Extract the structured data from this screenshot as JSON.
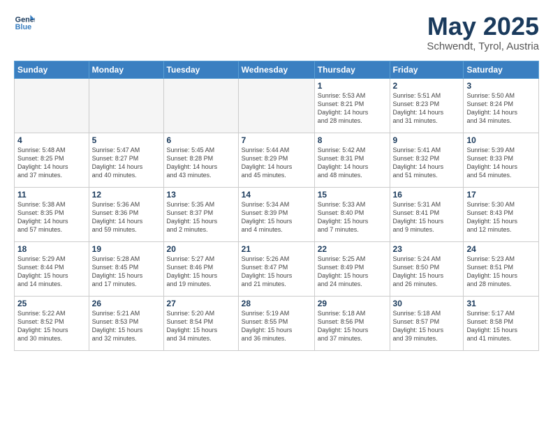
{
  "header": {
    "logo_line1": "General",
    "logo_line2": "Blue",
    "month": "May 2025",
    "location": "Schwendt, Tyrol, Austria"
  },
  "days_of_week": [
    "Sunday",
    "Monday",
    "Tuesday",
    "Wednesday",
    "Thursday",
    "Friday",
    "Saturday"
  ],
  "weeks": [
    [
      {
        "day": "",
        "info": ""
      },
      {
        "day": "",
        "info": ""
      },
      {
        "day": "",
        "info": ""
      },
      {
        "day": "",
        "info": ""
      },
      {
        "day": "1",
        "info": "Sunrise: 5:53 AM\nSunset: 8:21 PM\nDaylight: 14 hours\nand 28 minutes."
      },
      {
        "day": "2",
        "info": "Sunrise: 5:51 AM\nSunset: 8:23 PM\nDaylight: 14 hours\nand 31 minutes."
      },
      {
        "day": "3",
        "info": "Sunrise: 5:50 AM\nSunset: 8:24 PM\nDaylight: 14 hours\nand 34 minutes."
      }
    ],
    [
      {
        "day": "4",
        "info": "Sunrise: 5:48 AM\nSunset: 8:25 PM\nDaylight: 14 hours\nand 37 minutes."
      },
      {
        "day": "5",
        "info": "Sunrise: 5:47 AM\nSunset: 8:27 PM\nDaylight: 14 hours\nand 40 minutes."
      },
      {
        "day": "6",
        "info": "Sunrise: 5:45 AM\nSunset: 8:28 PM\nDaylight: 14 hours\nand 43 minutes."
      },
      {
        "day": "7",
        "info": "Sunrise: 5:44 AM\nSunset: 8:29 PM\nDaylight: 14 hours\nand 45 minutes."
      },
      {
        "day": "8",
        "info": "Sunrise: 5:42 AM\nSunset: 8:31 PM\nDaylight: 14 hours\nand 48 minutes."
      },
      {
        "day": "9",
        "info": "Sunrise: 5:41 AM\nSunset: 8:32 PM\nDaylight: 14 hours\nand 51 minutes."
      },
      {
        "day": "10",
        "info": "Sunrise: 5:39 AM\nSunset: 8:33 PM\nDaylight: 14 hours\nand 54 minutes."
      }
    ],
    [
      {
        "day": "11",
        "info": "Sunrise: 5:38 AM\nSunset: 8:35 PM\nDaylight: 14 hours\nand 57 minutes."
      },
      {
        "day": "12",
        "info": "Sunrise: 5:36 AM\nSunset: 8:36 PM\nDaylight: 14 hours\nand 59 minutes."
      },
      {
        "day": "13",
        "info": "Sunrise: 5:35 AM\nSunset: 8:37 PM\nDaylight: 15 hours\nand 2 minutes."
      },
      {
        "day": "14",
        "info": "Sunrise: 5:34 AM\nSunset: 8:39 PM\nDaylight: 15 hours\nand 4 minutes."
      },
      {
        "day": "15",
        "info": "Sunrise: 5:33 AM\nSunset: 8:40 PM\nDaylight: 15 hours\nand 7 minutes."
      },
      {
        "day": "16",
        "info": "Sunrise: 5:31 AM\nSunset: 8:41 PM\nDaylight: 15 hours\nand 9 minutes."
      },
      {
        "day": "17",
        "info": "Sunrise: 5:30 AM\nSunset: 8:43 PM\nDaylight: 15 hours\nand 12 minutes."
      }
    ],
    [
      {
        "day": "18",
        "info": "Sunrise: 5:29 AM\nSunset: 8:44 PM\nDaylight: 15 hours\nand 14 minutes."
      },
      {
        "day": "19",
        "info": "Sunrise: 5:28 AM\nSunset: 8:45 PM\nDaylight: 15 hours\nand 17 minutes."
      },
      {
        "day": "20",
        "info": "Sunrise: 5:27 AM\nSunset: 8:46 PM\nDaylight: 15 hours\nand 19 minutes."
      },
      {
        "day": "21",
        "info": "Sunrise: 5:26 AM\nSunset: 8:47 PM\nDaylight: 15 hours\nand 21 minutes."
      },
      {
        "day": "22",
        "info": "Sunrise: 5:25 AM\nSunset: 8:49 PM\nDaylight: 15 hours\nand 24 minutes."
      },
      {
        "day": "23",
        "info": "Sunrise: 5:24 AM\nSunset: 8:50 PM\nDaylight: 15 hours\nand 26 minutes."
      },
      {
        "day": "24",
        "info": "Sunrise: 5:23 AM\nSunset: 8:51 PM\nDaylight: 15 hours\nand 28 minutes."
      }
    ],
    [
      {
        "day": "25",
        "info": "Sunrise: 5:22 AM\nSunset: 8:52 PM\nDaylight: 15 hours\nand 30 minutes."
      },
      {
        "day": "26",
        "info": "Sunrise: 5:21 AM\nSunset: 8:53 PM\nDaylight: 15 hours\nand 32 minutes."
      },
      {
        "day": "27",
        "info": "Sunrise: 5:20 AM\nSunset: 8:54 PM\nDaylight: 15 hours\nand 34 minutes."
      },
      {
        "day": "28",
        "info": "Sunrise: 5:19 AM\nSunset: 8:55 PM\nDaylight: 15 hours\nand 36 minutes."
      },
      {
        "day": "29",
        "info": "Sunrise: 5:18 AM\nSunset: 8:56 PM\nDaylight: 15 hours\nand 37 minutes."
      },
      {
        "day": "30",
        "info": "Sunrise: 5:18 AM\nSunset: 8:57 PM\nDaylight: 15 hours\nand 39 minutes."
      },
      {
        "day": "31",
        "info": "Sunrise: 5:17 AM\nSunset: 8:58 PM\nDaylight: 15 hours\nand 41 minutes."
      }
    ]
  ]
}
